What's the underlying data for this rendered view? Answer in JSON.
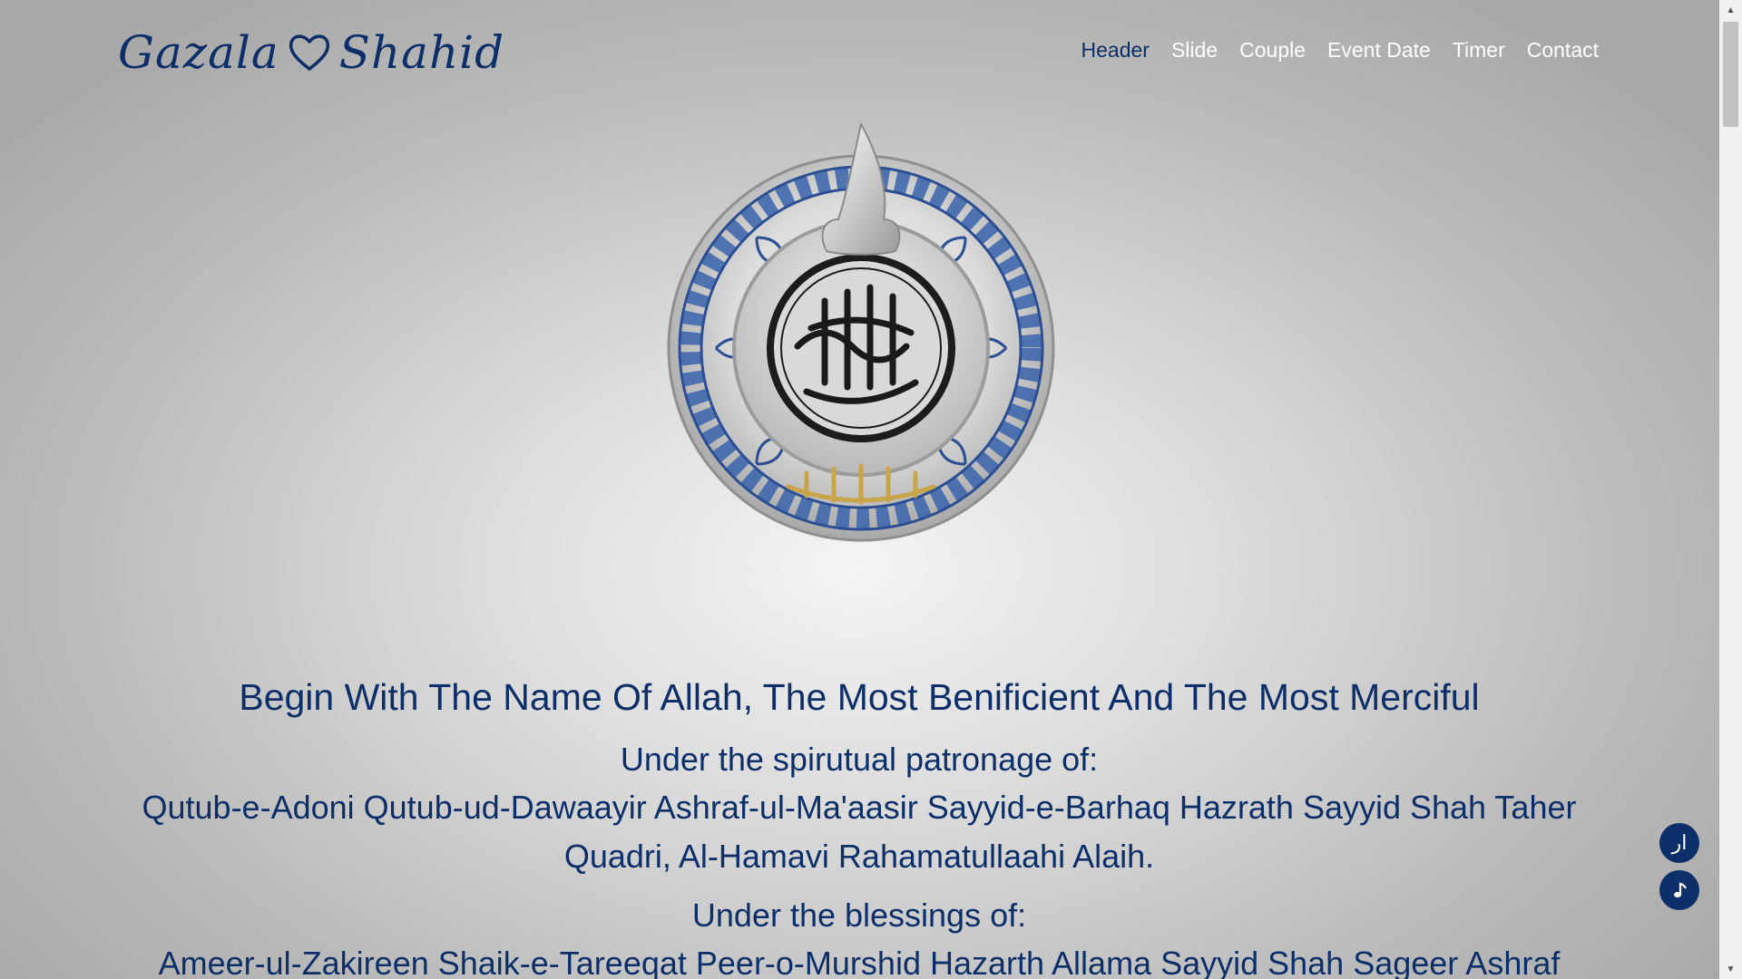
{
  "brand": {
    "first_name": "Gazala",
    "second_name": "Shahid",
    "heart_icon": "heart-outline-icon"
  },
  "nav": {
    "items": [
      {
        "label": "Header",
        "active": true
      },
      {
        "label": "Slide"
      },
      {
        "label": "Couple"
      },
      {
        "label": "Event Date"
      },
      {
        "label": "Timer"
      },
      {
        "label": "Contact"
      }
    ]
  },
  "colors": {
    "primary": "#0c2f69",
    "nav_inactive": "#ffffff",
    "emblem_blue": "#3a63ad",
    "emblem_gold": "#c8a548"
  },
  "emblem": {
    "icon": "bismillah-emblem-icon"
  },
  "content": {
    "basmala": "Begin With The Name Of Allah, The Most Benificient And The Most Merciful",
    "patronage_label": "Under the spirutual patronage of:",
    "patronage_names": "Qutub-e-Adoni Qutub-ud-Dawaayir Ashraf-ul-Ma'aasir Sayyid-e-Barhaq Hazrath Sayyid Shah Taher Quadri, Al-Hamavi Rahamatullaahi Alaih.",
    "blessings_label": "Under the blessings of:",
    "blessings_names": "Ameer-ul-Zakireen Shaik-e-Tareeqat Peer-o-Murshid Hazarth Allama Sayyid Shah Sageer Ashraf"
  },
  "floating": {
    "language_label": "ار",
    "music_icon": "music-note-icon"
  }
}
